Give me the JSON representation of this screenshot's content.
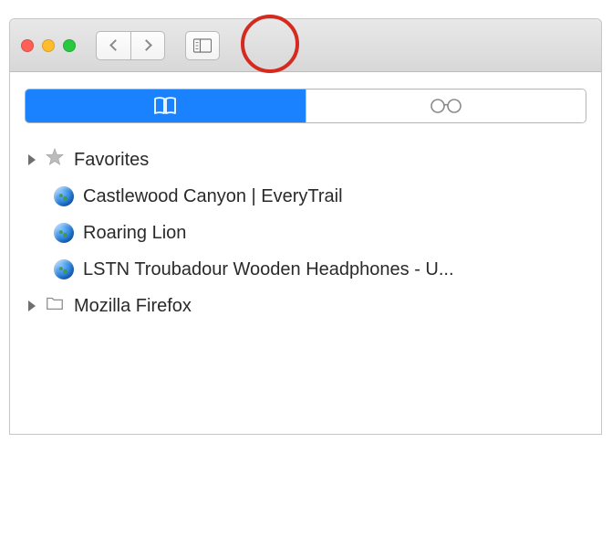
{
  "colors": {
    "accent": "#1a82ff",
    "highlight_ring": "#d42a1f"
  },
  "titlebar": {
    "buttons": {
      "close": "close",
      "minimize": "minimize",
      "maximize": "maximize",
      "back": "back",
      "forward": "forward",
      "sidebar_toggle": "sidebar"
    }
  },
  "tabs": {
    "bookmarks": {
      "name": "Bookmarks",
      "active": true
    },
    "reading_list": {
      "name": "Reading List",
      "active": false
    }
  },
  "items": {
    "favorites": {
      "label": "Favorites"
    },
    "r0": {
      "label": "Castlewood Canyon | EveryTrail"
    },
    "r1": {
      "label": "Roaring Lion"
    },
    "r2": {
      "label": "LSTN Troubadour Wooden Headphones - U..."
    },
    "folder0": {
      "label": "Mozilla Firefox"
    }
  }
}
